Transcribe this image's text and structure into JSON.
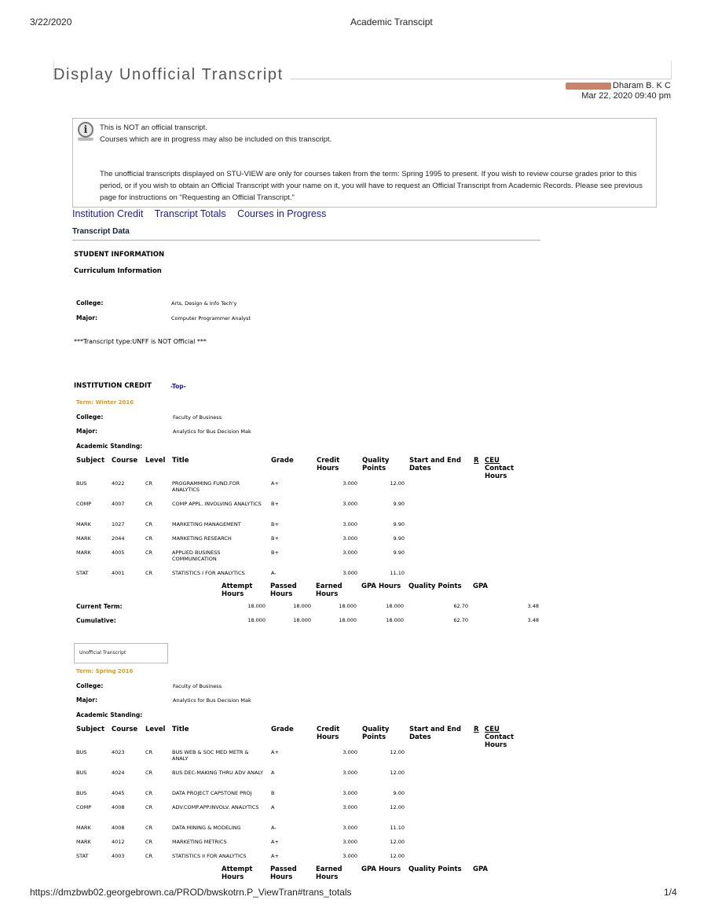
{
  "print_header": {
    "date": "3/22/2020",
    "doc_title": "Academic Transcipt"
  },
  "page_title": "Display Unofficial Transcript",
  "user": {
    "name": "Dharam B. K C",
    "datetime": "Mar 22, 2020 09:40 pm"
  },
  "notice": {
    "line1": "This is NOT an official transcript.",
    "line2": "Courses which are in progress may also be included on this transcript.",
    "paragraph": "The unofficial transcripts displayed on STU-VIEW are only for courses taken from the term: Spring 1995 to present. If you wish to review course grades prior to this period, or if you wish to obtain an Official Transcript with your name on it, you will have to request an Official Transcript from Academic Records. Please see previous page for instructions on \"Requesting an Official Transcript.\""
  },
  "nav_links": [
    "Institution Credit",
    "Transcript Totals",
    "Courses in Progress"
  ],
  "transcript_data_title": "Transcript Data",
  "student_info": {
    "heading": "STUDENT INFORMATION",
    "curriculum": "Curriculum Information",
    "college_label": "College:",
    "college": "Arts, Design & Info Tech'y",
    "major_label": "Major:",
    "major": "Computer Programmer Analyst",
    "transcript_type": "***Transcript type:UNFF is NOT Official ***"
  },
  "institution_credit": {
    "heading": "INSTITUTION CREDIT",
    "top_link": "-Top-"
  },
  "table_headers": {
    "subject": "Subject",
    "course": "Course",
    "level": "Level",
    "title": "Title",
    "grade": "Grade",
    "credit_hours": "Credit Hours",
    "quality_points": "Quality Points",
    "dates": "Start and End Dates",
    "r": "R",
    "ceu": "CEU",
    "contact_hours": "Contact Hours"
  },
  "totals_headers": {
    "attempt": "Attempt Hours",
    "passed": "Passed Hours",
    "earned": "Earned Hours",
    "gpa_hours": "GPA Hours",
    "quality_points": "Quality Points",
    "gpa": "GPA"
  },
  "labels": {
    "college": "College:",
    "major": "Major:",
    "standing": "Academic Standing:",
    "current_term": "Current Term:",
    "cumulative": "Cumulative:"
  },
  "terms": [
    {
      "name": "Term: Winter 2016",
      "college": "Faculty of Business",
      "major": "Analytics for Bus Decision Mak",
      "courses": [
        [
          "BUS",
          "4022",
          "CR",
          "PROGRAMMING FUND.FOR ANALYTICS",
          "A+",
          "3.000",
          "12.00"
        ],
        [
          "COMP",
          "4007",
          "CR",
          "COMP APPL. INVOLVING ANALYTICS",
          "B+",
          "3.000",
          "9.90"
        ],
        [
          "MARK",
          "1027",
          "CR",
          "MARKETING MANAGEMENT",
          "B+",
          "3.000",
          "9.90"
        ],
        [
          "MARK",
          "2044",
          "CR",
          "MARKETING RESEARCH",
          "B+",
          "3.000",
          "9.90"
        ],
        [
          "MARK",
          "4005",
          "CR",
          "APPLIED BUSINESS COMMUNICATION",
          "B+",
          "3.000",
          "9.90"
        ],
        [
          "STAT",
          "4001",
          "CR",
          "STATISTICS I FOR ANALYTICS",
          "A-",
          "3.000",
          "11.10"
        ]
      ],
      "current_term": [
        "18.000",
        "18.000",
        "18.000",
        "18.000",
        "62.70",
        "3.48"
      ],
      "cumulative": [
        "18.000",
        "18.000",
        "18.000",
        "18.000",
        "62.70",
        "3.48"
      ]
    },
    {
      "name": "Term: Spring 2016",
      "college": "Faculty of Business",
      "major": "Analytics for Bus Decision Mak",
      "courses": [
        [
          "BUS",
          "4023",
          "CR",
          "BUS WEB & SOC MED METR & ANALY",
          "A+",
          "3.000",
          "12.00"
        ],
        [
          "BUS",
          "4024",
          "CR",
          "BUS DEC-MAKING THRU ADV ANALY",
          "A",
          "3.000",
          "12.00"
        ],
        [
          "BUS",
          "4045",
          "CR",
          "DATA PROJECT CAPSTONE PROJ",
          "B",
          "3.000",
          "9.00"
        ],
        [
          "COMP",
          "4008",
          "CR",
          "ADV.COMP.APP.INVOLV. ANALYTICS",
          "A",
          "3.000",
          "12.00"
        ],
        [
          "MARK",
          "4008",
          "CR",
          "DATA MINING & MODELING",
          "A-",
          "3.000",
          "11.10"
        ],
        [
          "MARK",
          "4012",
          "CR",
          "MARKETING METRICS",
          "A+",
          "3.000",
          "12.00"
        ],
        [
          "STAT",
          "4003",
          "CR",
          "STATISTICS II FOR ANALYTICS",
          "A+",
          "3.000",
          "12.00"
        ]
      ]
    }
  ],
  "unofficial_box": "Unofficial Transcript",
  "footer": {
    "url": "https://dmzbwb02.georgebrown.ca/PROD/bwskotrn.P_ViewTran#trans_totals",
    "page": "1/4"
  }
}
